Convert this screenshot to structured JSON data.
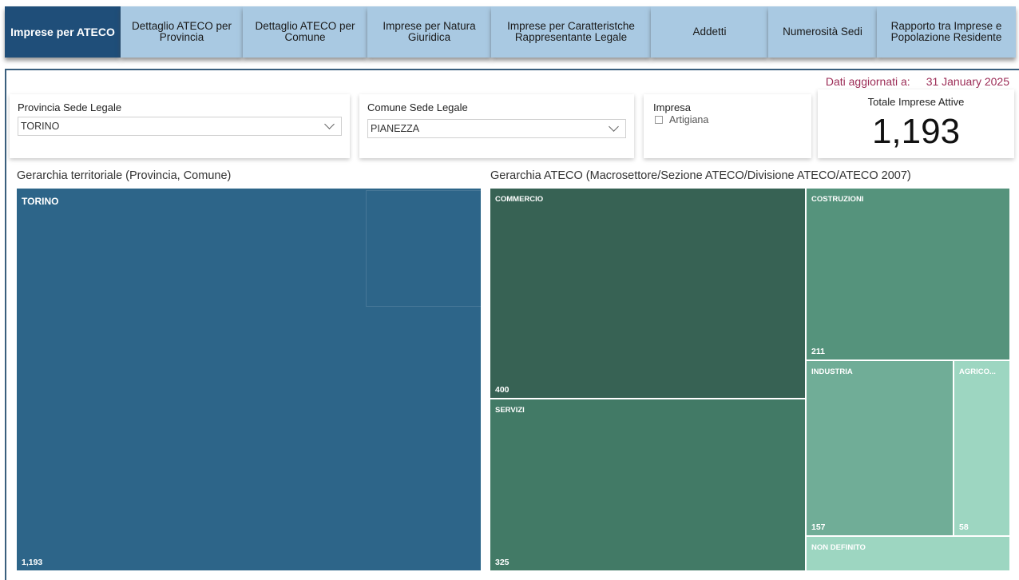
{
  "tabs": [
    {
      "label": "Imprese per ATECO",
      "active": true
    },
    {
      "label": "Dettaglio ATECO per\nProvincia",
      "active": false
    },
    {
      "label": "Dettaglio ATECO per\nComune",
      "active": false
    },
    {
      "label": "Imprese per Natura\nGiuridica",
      "active": false
    },
    {
      "label": "Imprese per Caratteristche\nRappresentante Legale",
      "active": false
    },
    {
      "label": "Addetti",
      "active": false
    },
    {
      "label": "Numerosità Sedi",
      "active": false
    },
    {
      "label": "Rapporto tra Imprese e\nPopolazione Residente",
      "active": false
    }
  ],
  "updated": {
    "label": "Dati aggiornati a:",
    "date": "31 January 2025"
  },
  "filters": {
    "provincia": {
      "title": "Provincia Sede Legale",
      "value": "TORINO"
    },
    "comune": {
      "title": "Comune Sede Legale",
      "value": "PIANEZZA"
    },
    "impresa": {
      "title": "Impresa",
      "option": "Artigiana",
      "checked": false
    }
  },
  "kpi": {
    "title": "Totale Imprese Attive",
    "value": "1,193"
  },
  "territorial": {
    "title": "Gerarchia territoriale (Provincia, Comune)",
    "tiles": [
      {
        "label": "TORINO",
        "value": "1,193",
        "color": "#2d6589"
      }
    ]
  },
  "ateco": {
    "title": "Gerarchia ATECO (Macrosettore/Sezione ATECO/Divisione ATECO/ATECO 2007)",
    "tiles": [
      {
        "label": "COMMERCIO",
        "value": "400",
        "color": "#376254"
      },
      {
        "label": "SERVIZI",
        "value": "325",
        "color": "#427a66"
      },
      {
        "label": "COSTRUZIONI",
        "value": "211",
        "color": "#55937c"
      },
      {
        "label": "INDUSTRIA",
        "value": "157",
        "color": "#70ad97"
      },
      {
        "label": "AGRICO...",
        "value": "58",
        "color": "#9dd6c1"
      },
      {
        "label": "NON DEFINITO",
        "value": "",
        "color": "#9dd6c1"
      }
    ]
  },
  "colors": {
    "tab_bg": "#a9c9e2",
    "tab_active": "#1f4e79",
    "updated_text": "#9b2b55"
  }
}
